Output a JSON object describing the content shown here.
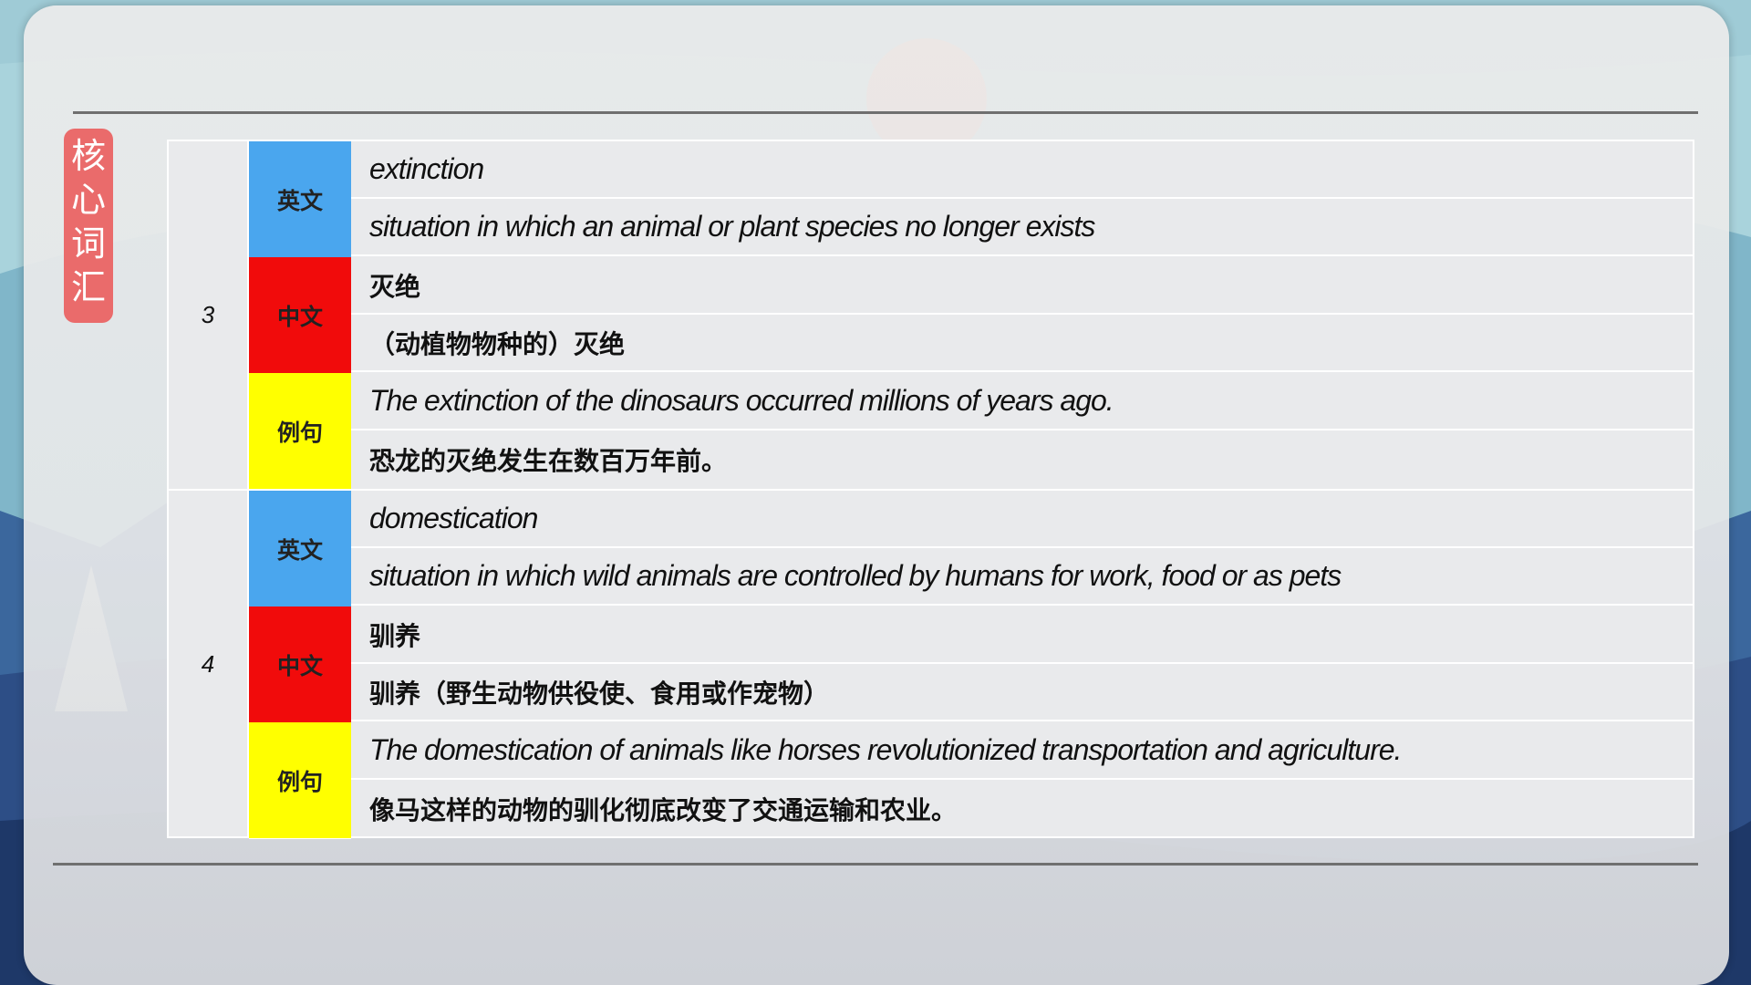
{
  "badge": {
    "chars": [
      "核",
      "心",
      "词",
      "汇"
    ]
  },
  "entries": [
    {
      "number": "3",
      "labels": {
        "english": "英文",
        "chinese": "中文",
        "example": "例句"
      },
      "word": "extinction",
      "definition": "situation in which an animal or plant species no longer exists",
      "zh_word": "灭绝",
      "zh_definition": "（动植物物种的）灭绝",
      "example_en": "The extinction of the dinosaurs occurred millions of years ago.",
      "example_zh": "恐龙的灭绝发生在数百万年前。"
    },
    {
      "number": "4",
      "labels": {
        "english": "英文",
        "chinese": "中文",
        "example": "例句"
      },
      "word": "domestication",
      "definition": "situation in which wild animals are controlled by humans for work, food or as pets",
      "zh_word": "驯养",
      "zh_definition": "驯养（野生动物供役使、食用或作宠物）",
      "example_en": "The domestication of animals like horses revolutionized transportation and agriculture.",
      "example_zh": "像马这样的动物的驯化彻底改变了交通运输和农业。"
    }
  ],
  "colors": {
    "english_label": "#4aa6ee",
    "chinese_label": "#f10b0b",
    "example_label": "#ffff00",
    "badge": "#ea6b6b"
  }
}
